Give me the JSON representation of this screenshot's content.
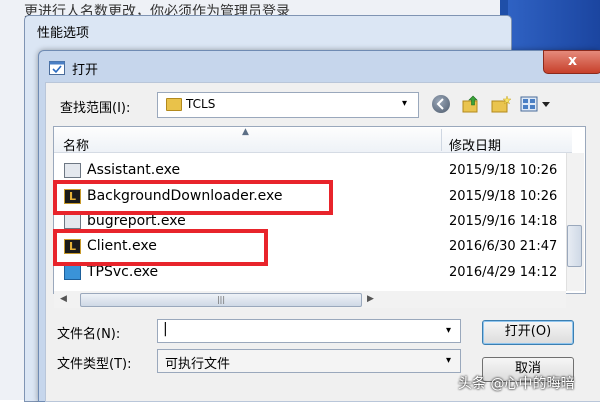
{
  "background": {
    "partial_text": "更进行人名数更改，你必须作为管理员登录"
  },
  "perf_window": {
    "title": "性能选项"
  },
  "open_dialog": {
    "title": "打开",
    "close_glyph": "x",
    "look_in": {
      "label": "查找范围(I):",
      "value": "TCLS",
      "arrow": "▾"
    },
    "toolbar_icons": [
      "back-icon",
      "up-folder-icon",
      "new-folder-icon",
      "view-menu-icon"
    ],
    "file_list": {
      "columns": [
        "名称",
        "修改日期"
      ],
      "sort_glyph": "▲",
      "rows": [
        {
          "name": "Assistant.exe",
          "date": "2015/9/18 10:26",
          "icon": "exe-window-icon"
        },
        {
          "name": "BackgroundDownloader.exe",
          "date": "2015/9/18 10:26",
          "icon": "lol-logo-icon"
        },
        {
          "name": "bugreport.exe",
          "date": "2015/9/16 14:18",
          "icon": "generic-exe-icon"
        },
        {
          "name": "Client.exe",
          "date": "2016/6/30 21:47",
          "icon": "lol-logo-icon"
        },
        {
          "name": "TPSvc.exe",
          "date": "2016/4/29 14:12",
          "icon": "service-icon"
        }
      ]
    },
    "file_name": {
      "label": "文件名(N):",
      "value": "|"
    },
    "file_type": {
      "label": "文件类型(T):",
      "value": "可执行文件"
    },
    "buttons": {
      "open": "打开(O)",
      "cancel": "取消"
    },
    "scroll_glyphs": {
      "left": "◀",
      "right": "▶",
      "grip": "|||"
    }
  },
  "annotations": {
    "highlighted_files": [
      "BackgroundDownloader.exe",
      "Client.exe"
    ],
    "highlight_color": "#e8242b"
  },
  "watermark": "头条 @心中的晦暗"
}
